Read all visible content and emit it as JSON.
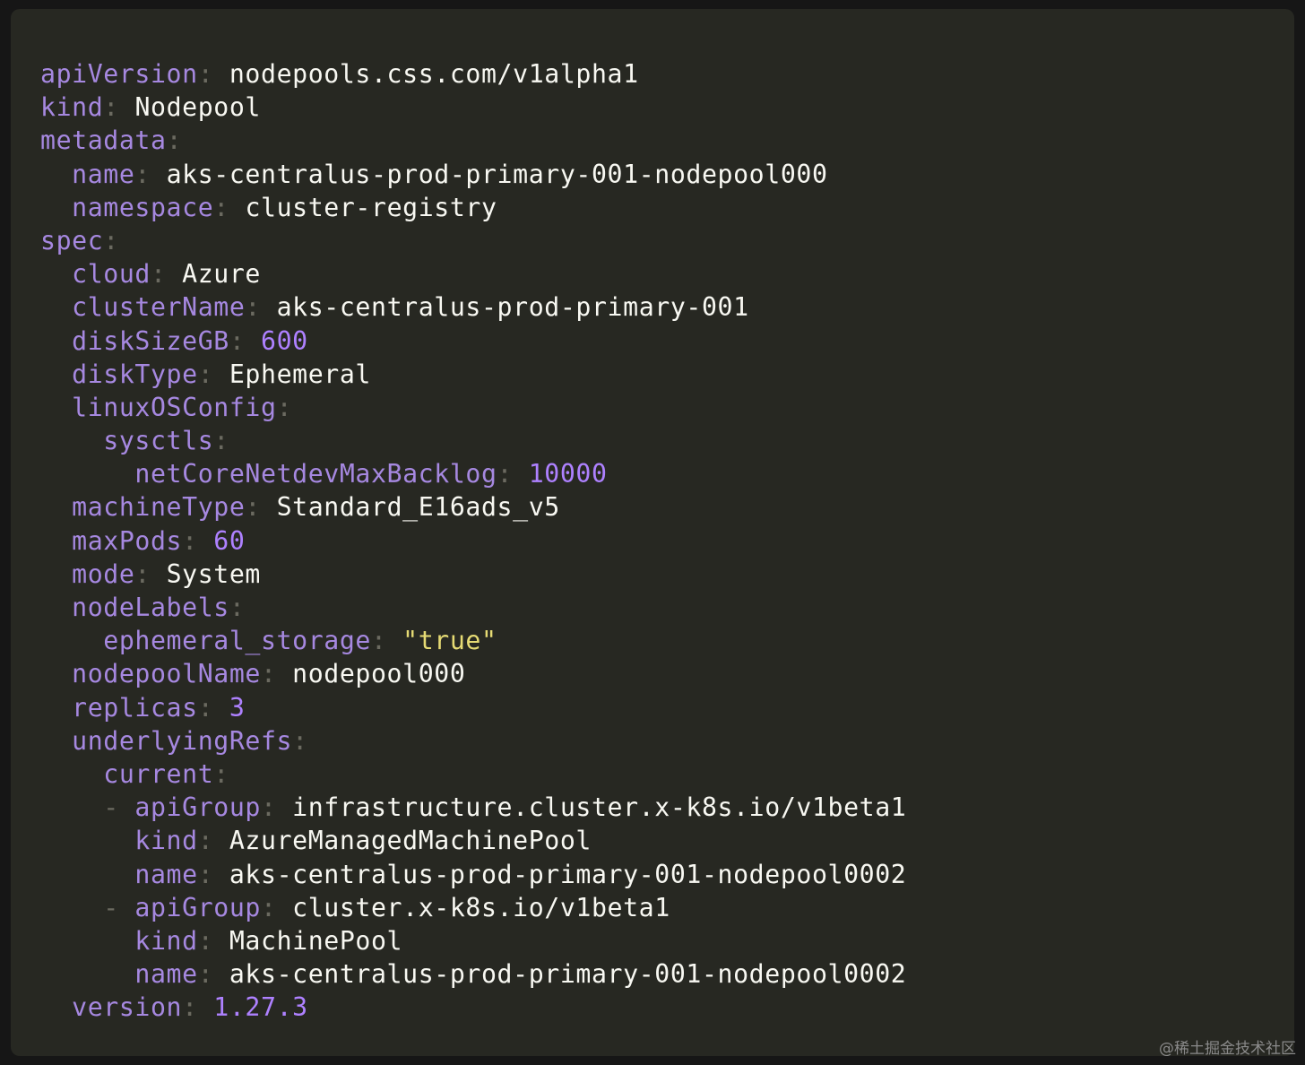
{
  "colors": {
    "background": "#272822",
    "key": "#a688e0",
    "punctuation": "#6b6a60",
    "string": "#f8f8f2",
    "number": "#ae81ff",
    "quoted_string": "#e6db74"
  },
  "code_lines": [
    {
      "indent": 0,
      "dash": false,
      "key": "apiVersion",
      "value": "nodepools.css.com/v1alpha1",
      "vtype": "str"
    },
    {
      "indent": 0,
      "dash": false,
      "key": "kind",
      "value": "Nodepool",
      "vtype": "str"
    },
    {
      "indent": 0,
      "dash": false,
      "key": "metadata",
      "value": "",
      "vtype": "none"
    },
    {
      "indent": 1,
      "dash": false,
      "key": "name",
      "value": "aks-centralus-prod-primary-001-nodepool000",
      "vtype": "str"
    },
    {
      "indent": 1,
      "dash": false,
      "key": "namespace",
      "value": "cluster-registry",
      "vtype": "str"
    },
    {
      "indent": 0,
      "dash": false,
      "key": "spec",
      "value": "",
      "vtype": "none"
    },
    {
      "indent": 1,
      "dash": false,
      "key": "cloud",
      "value": "Azure",
      "vtype": "str"
    },
    {
      "indent": 1,
      "dash": false,
      "key": "clusterName",
      "value": "aks-centralus-prod-primary-001",
      "vtype": "str"
    },
    {
      "indent": 1,
      "dash": false,
      "key": "diskSizeGB",
      "value": "600",
      "vtype": "num"
    },
    {
      "indent": 1,
      "dash": false,
      "key": "diskType",
      "value": "Ephemeral",
      "vtype": "str"
    },
    {
      "indent": 1,
      "dash": false,
      "key": "linuxOSConfig",
      "value": "",
      "vtype": "none"
    },
    {
      "indent": 2,
      "dash": false,
      "key": "sysctls",
      "value": "",
      "vtype": "none"
    },
    {
      "indent": 3,
      "dash": false,
      "key": "netCoreNetdevMaxBacklog",
      "value": "10000",
      "vtype": "num"
    },
    {
      "indent": 1,
      "dash": false,
      "key": "machineType",
      "value": "Standard_E16ads_v5",
      "vtype": "str"
    },
    {
      "indent": 1,
      "dash": false,
      "key": "maxPods",
      "value": "60",
      "vtype": "num"
    },
    {
      "indent": 1,
      "dash": false,
      "key": "mode",
      "value": "System",
      "vtype": "str"
    },
    {
      "indent": 1,
      "dash": false,
      "key": "nodeLabels",
      "value": "",
      "vtype": "none"
    },
    {
      "indent": 2,
      "dash": false,
      "key": "ephemeral_storage",
      "value": "\"true\"",
      "vtype": "quoted"
    },
    {
      "indent": 1,
      "dash": false,
      "key": "nodepoolName",
      "value": "nodepool000",
      "vtype": "str"
    },
    {
      "indent": 1,
      "dash": false,
      "key": "replicas",
      "value": "3",
      "vtype": "num"
    },
    {
      "indent": 1,
      "dash": false,
      "key": "underlyingRefs",
      "value": "",
      "vtype": "none"
    },
    {
      "indent": 2,
      "dash": false,
      "key": "current",
      "value": "",
      "vtype": "none"
    },
    {
      "indent": 2,
      "dash": true,
      "key": "apiGroup",
      "value": "infrastructure.cluster.x-k8s.io/v1beta1",
      "vtype": "str"
    },
    {
      "indent": 3,
      "dash": false,
      "key": "kind",
      "value": "AzureManagedMachinePool",
      "vtype": "str"
    },
    {
      "indent": 3,
      "dash": false,
      "key": "name",
      "value": "aks-centralus-prod-primary-001-nodepool0002",
      "vtype": "str"
    },
    {
      "indent": 2,
      "dash": true,
      "key": "apiGroup",
      "value": "cluster.x-k8s.io/v1beta1",
      "vtype": "str"
    },
    {
      "indent": 3,
      "dash": false,
      "key": "kind",
      "value": "MachinePool",
      "vtype": "str"
    },
    {
      "indent": 3,
      "dash": false,
      "key": "name",
      "value": "aks-centralus-prod-primary-001-nodepool0002",
      "vtype": "str"
    },
    {
      "indent": 1,
      "dash": false,
      "key": "version",
      "value": "1.27.3",
      "vtype": "num"
    }
  ],
  "watermark": "@稀土掘金技术社区"
}
